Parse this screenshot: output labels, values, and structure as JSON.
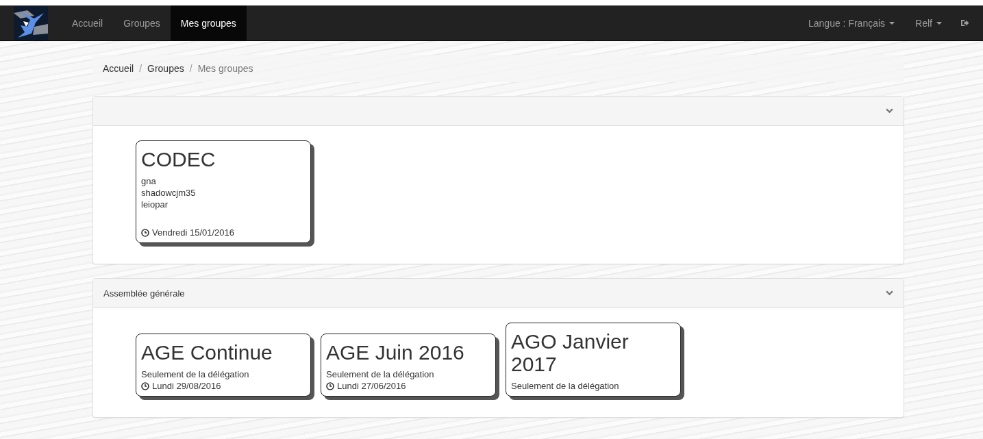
{
  "navbar": {
    "items": [
      {
        "label": "Accueil",
        "selected": false
      },
      {
        "label": "Groupes",
        "selected": false
      },
      {
        "label": "Mes groupes",
        "selected": true
      }
    ],
    "language": "Langue : Français",
    "user": "Relf"
  },
  "breadcrumb": [
    {
      "label": "Accueil",
      "current": false
    },
    {
      "separator": "/",
      "label": "Groupes",
      "current": false
    },
    {
      "separator": "/",
      "label": "Mes groupes",
      "current": true
    }
  ],
  "panels": [
    {
      "expanded": true,
      "groups": [
        {
          "name": "CODEC",
          "members": [
            "gna",
            "shadowcjm35",
            "leiopar"
          ],
          "date": "Vendredi 15/01/2016"
        }
      ]
    },
    {
      "title": "Assemblée générale",
      "expanded": true,
      "groups": [
        {
          "name": "AGE Continue",
          "note": "Seulement de la délégation",
          "date": "Lundi 29/08/2016"
        },
        {
          "name": "AGE Juin 2016",
          "note": "Seulement de la délégation",
          "date": "Lundi 27/06/2016"
        },
        {
          "name": "AGO Janvier 2017",
          "note": "Seulement de la délégation"
        }
      ]
    }
  ]
}
